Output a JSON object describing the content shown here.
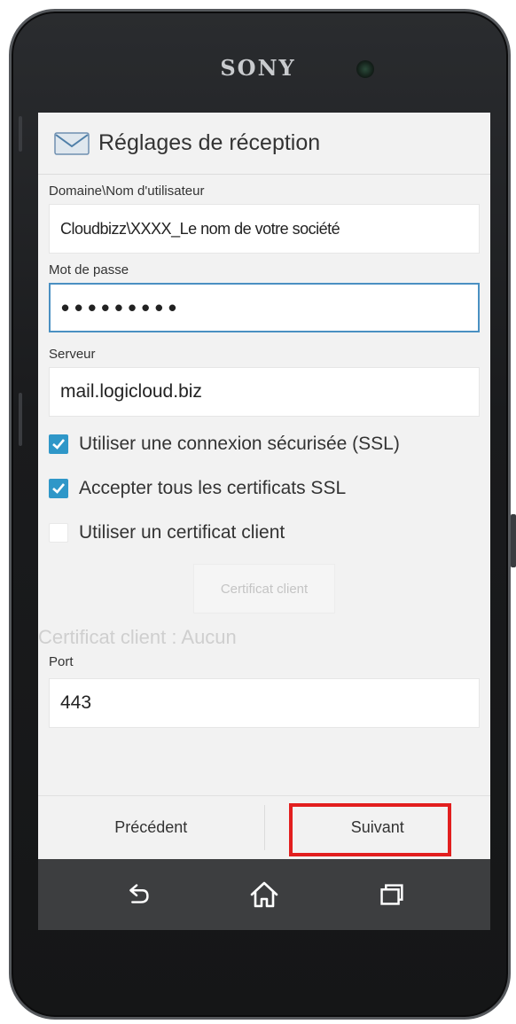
{
  "device": {
    "brand": "SONY"
  },
  "header": {
    "title": "Réglages de réception",
    "icon": "mail-icon"
  },
  "form": {
    "username_label": "Domaine\\Nom d'utilisateur",
    "username_value": "Cloudbizz\\XXXX_Le nom de votre société",
    "password_label": "Mot de passe",
    "password_value": "•••••••••",
    "server_label": "Serveur",
    "server_value": "mail.logicloud.biz",
    "options": [
      {
        "label": "Utiliser une connexion sécurisée (SSL)",
        "checked": true
      },
      {
        "label": "Accepter tous les certificats SSL",
        "checked": true
      },
      {
        "label": "Utiliser un certificat client",
        "checked": false
      }
    ],
    "client_cert_button": "Certificat client",
    "client_cert_status": "Certificat client : Aucun",
    "port_label": "Port",
    "port_value": "443"
  },
  "footer": {
    "previous_label": "Précédent",
    "next_label": "Suivant"
  },
  "navbar": {
    "icons": [
      "back-icon",
      "home-icon",
      "recent-apps-icon"
    ]
  },
  "colors": {
    "accent": "#2f97c8",
    "highlight": "#e21f1f",
    "focus": "#4a90c2"
  }
}
